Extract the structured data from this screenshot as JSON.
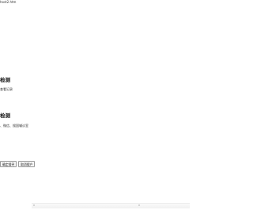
{
  "browser": {
    "url_label": "host2.htm"
  },
  "sections": [
    {
      "title": "检测",
      "description": "查看记录"
    },
    {
      "title": "检测",
      "description": "、微信、搜国辅诊室"
    }
  ],
  "actions": {
    "confirm_label": "确定搜寻",
    "cancel_label": "取消搜户"
  },
  "icons": {
    "small_dot": "dot-icon"
  }
}
